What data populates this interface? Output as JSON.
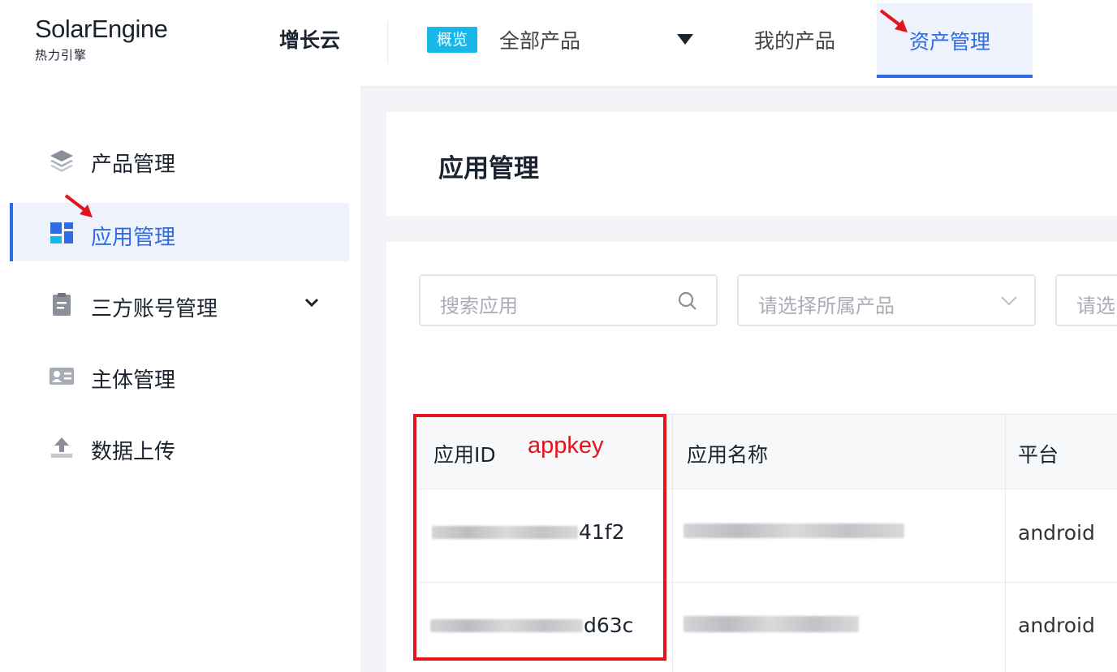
{
  "header": {
    "logo_main": "SolarEngine",
    "logo_sub": "热力引擎",
    "nav_growth": "增长云",
    "overview_badge": "概览",
    "all_products": "全部产品",
    "my_products": "我的产品",
    "asset_management": "资产管理"
  },
  "sidebar": {
    "items": [
      {
        "label": "产品管理",
        "icon": "layers-icon"
      },
      {
        "label": "应用管理",
        "icon": "app-grid-icon",
        "active": true
      },
      {
        "label": "三方账号管理",
        "icon": "clipboard-icon",
        "expandable": true
      },
      {
        "label": "主体管理",
        "icon": "id-card-icon"
      },
      {
        "label": "数据上传",
        "icon": "upload-icon"
      }
    ]
  },
  "main": {
    "title": "应用管理",
    "search_placeholder": "搜索应用",
    "product_select_placeholder": "请选择所属产品",
    "third_select_placeholder": "请选",
    "table": {
      "columns": [
        "应用ID",
        "应用名称",
        "平台"
      ],
      "rows": [
        {
          "app_id_suffix": "41f2",
          "platform": "android"
        },
        {
          "app_id_suffix": "d63c",
          "platform": "android"
        }
      ]
    }
  },
  "annotation": {
    "label": "appkey",
    "color": "#e3141b"
  },
  "colors": {
    "accent": "#2e6be6",
    "badge": "#17b8e8",
    "annotation_red": "#e3141b"
  }
}
